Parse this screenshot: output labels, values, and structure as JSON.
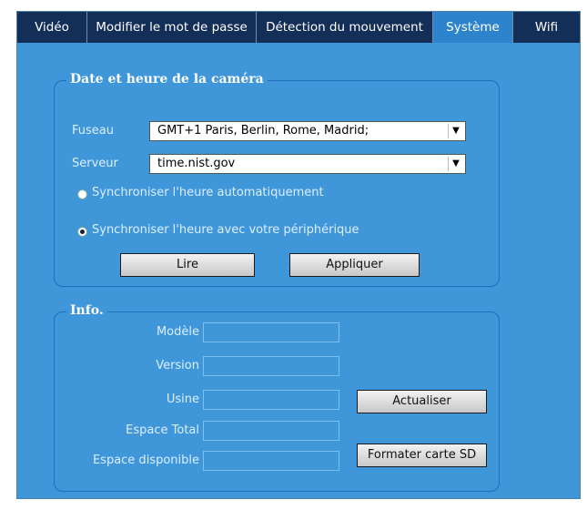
{
  "tabs": [
    {
      "label": "Vidéo",
      "active": false
    },
    {
      "label": "Modifier le mot de passe",
      "active": false
    },
    {
      "label": "Détection du mouvement",
      "active": false
    },
    {
      "label": "Système",
      "active": true
    },
    {
      "label": "Wifi",
      "active": false
    }
  ],
  "datetime": {
    "legend": "Date et heure de la caméra",
    "timezone_label": "Fuseau",
    "timezone_value": "GMT+1  Paris, Berlin, Rome, Madrid;",
    "server_label": "Serveur",
    "server_value": "time.nist.gov",
    "radio_auto": "Synchroniser l'heure automatiquement",
    "radio_device": "Synchroniser l'heure avec votre périphérique",
    "selected_radio": "device",
    "read_button": "Lire",
    "apply_button": "Appliquer"
  },
  "info": {
    "legend": "Info.",
    "model_label": "Modèle",
    "version_label": "Version",
    "factory_label": "Usine",
    "total_space_label": "Espace Total",
    "free_space_label": "Espace disponible",
    "refresh_button": "Actualiser",
    "format_button": "Formater carte SD"
  },
  "colors": {
    "panel": "#3f97d9",
    "tab_bar": "#132e57",
    "tab_active": "#2e84cc",
    "border": "#1f6fb8"
  }
}
